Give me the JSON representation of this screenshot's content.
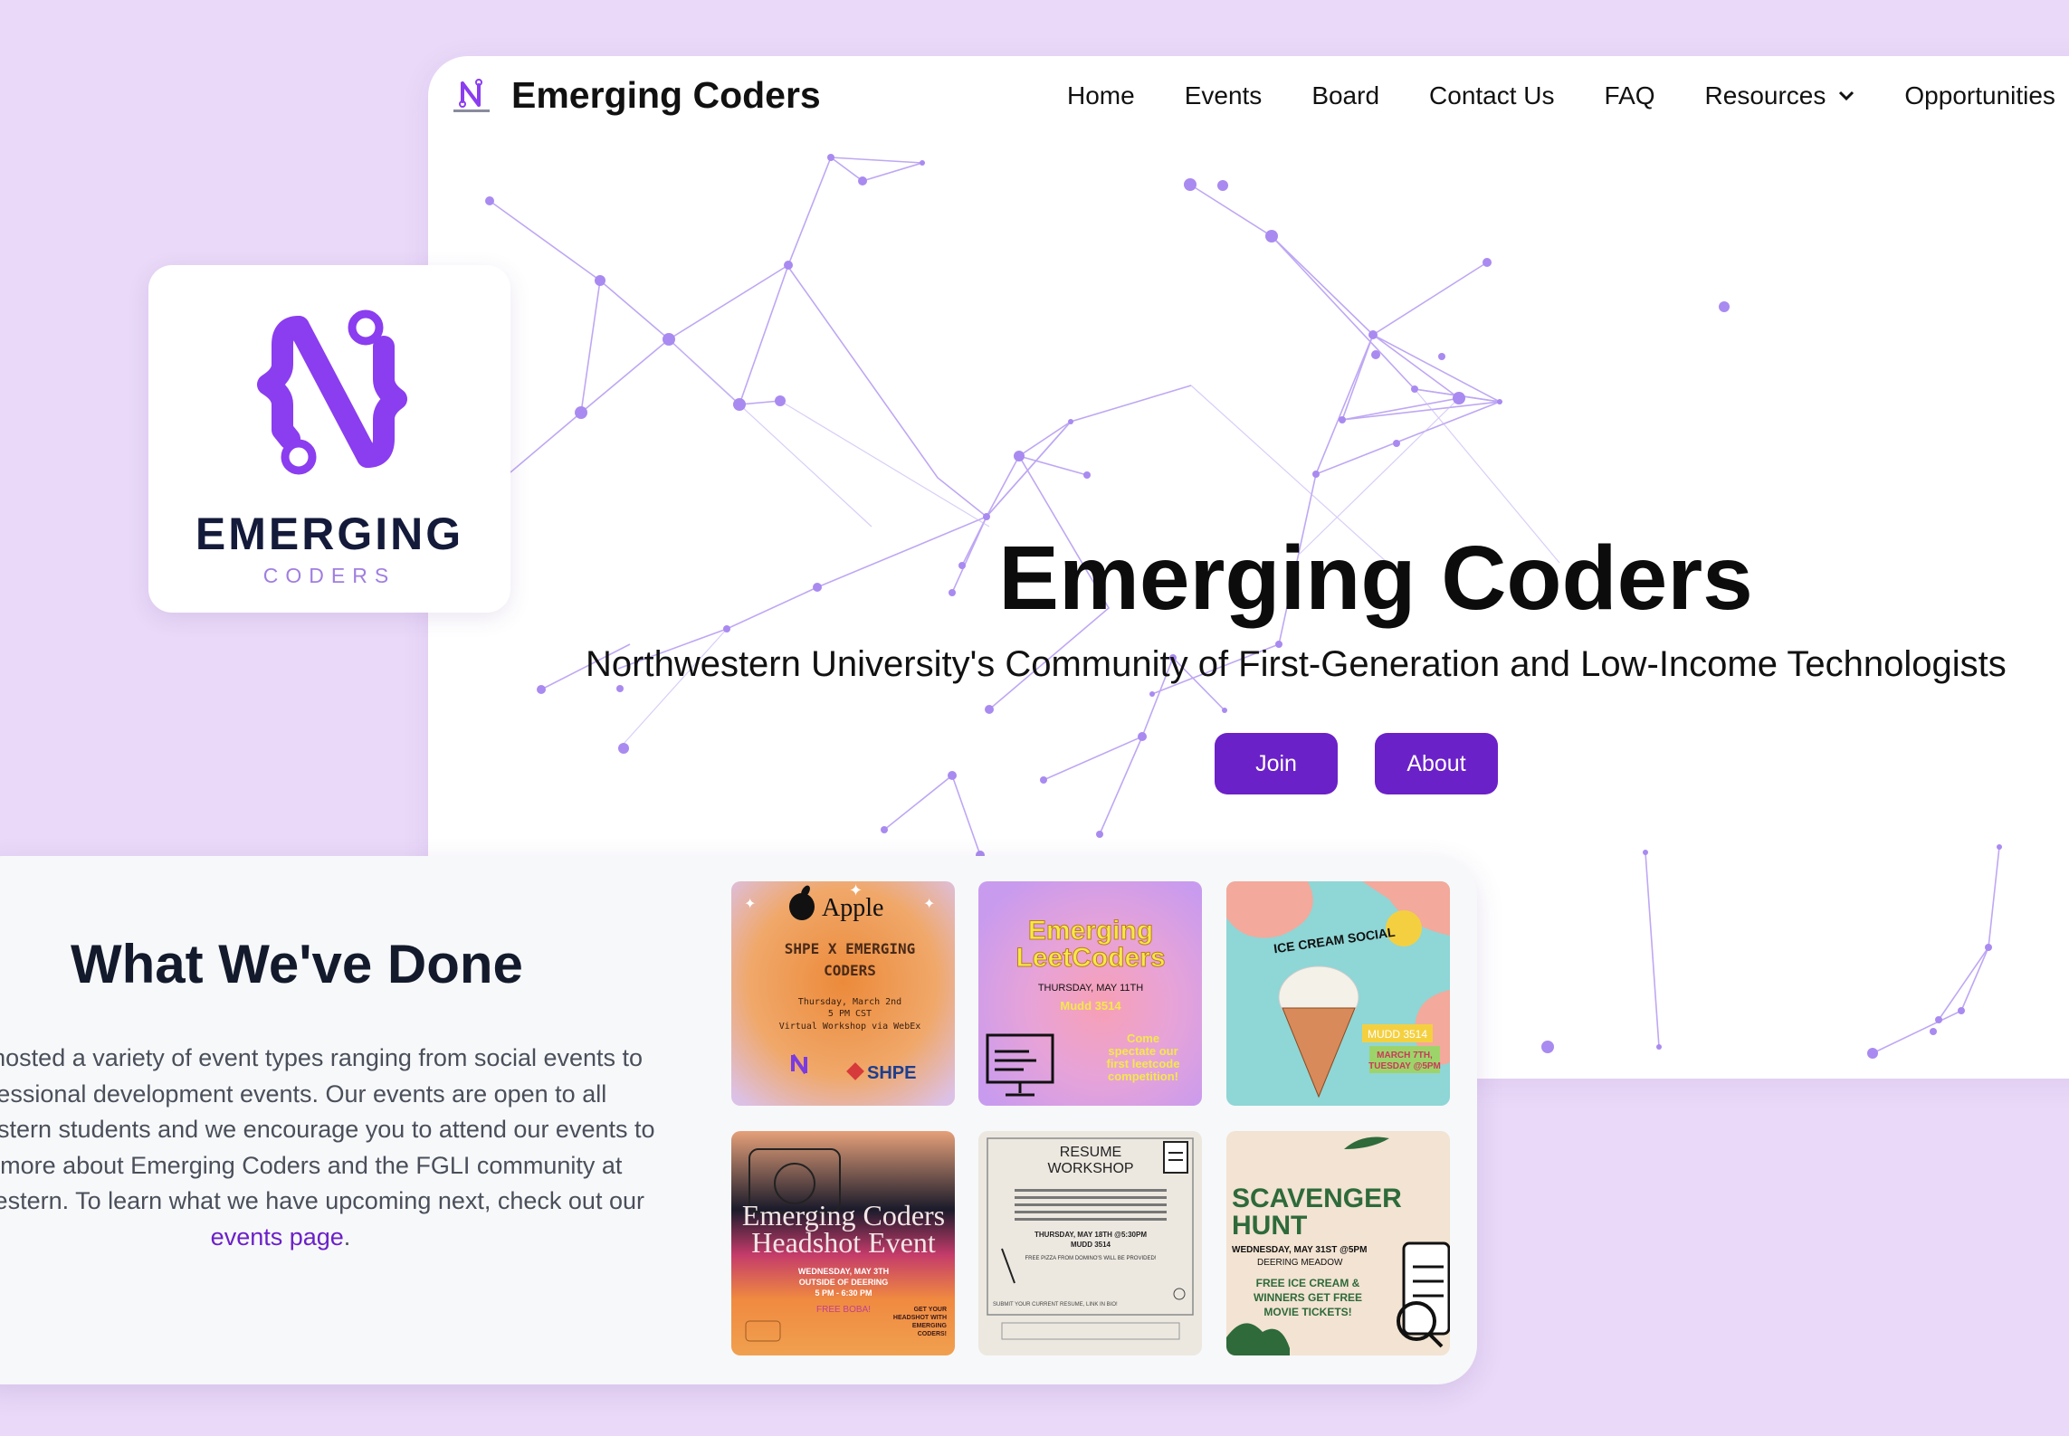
{
  "site": {
    "title": "Emerging Coders",
    "nav": [
      "Home",
      "Events",
      "Board",
      "Contact Us",
      "FAQ",
      "Resources",
      "Opportunities"
    ]
  },
  "hero": {
    "title": "Emerging Coders",
    "subtitle": "Northwestern University's Community of First-Generation and Low-Income Technologists",
    "join_label": "Join",
    "about_label": "About"
  },
  "logo_card": {
    "word": "EMERGING",
    "sub": "CODERS"
  },
  "done": {
    "title": "What We've Done",
    "text": "We've hosted a variety of event types ranging from social events to professional development events. Our events are open to all Northwestern students and we encourage you to attend our events to learn more about Emerging Coders and the FGLI community at Northwestern. To learn what we have upcoming next, check out our ",
    "link_label": "events page",
    "after_link": "."
  },
  "tiles": {
    "t1": {
      "brand": "Apple",
      "l1": "SHPE X EMERGING",
      "l2": "CODERS",
      "l3": "Thursday, March 2nd",
      "l4": "5 PM CST",
      "l5": "Virtual Workshop via WebEx",
      "partner": "SHPE"
    },
    "t2": {
      "l1": "Emerging",
      "l2": "LeetCoders",
      "l3": "THURSDAY, MAY 11TH",
      "l4": "Mudd 3514",
      "l5": "Come",
      "l6": "spectate our",
      "l7": "first leetcode",
      "l8": "competition!"
    },
    "t3": {
      "l1": "ICE CREAM SOCIAL",
      "l2": "MUDD 3514",
      "l3": "MARCH 7TH,",
      "l4": "TUESDAY @5PM"
    },
    "t4": {
      "l1": "Emerging Coders",
      "l2": "Headshot Event",
      "l3": "WEDNESDAY, MAY 3TH",
      "l4": "OUTSIDE OF DEERING",
      "l5": "5 PM - 6:30 PM",
      "l6": "FREE BOBA!",
      "l7": "GET YOUR",
      "l8": "HEADSHOT WITH",
      "l9": "EMERGING",
      "l10": "CODERS!"
    },
    "t5": {
      "l1": "RESUME",
      "l2": "WORKSHOP",
      "l3": "THURSDAY, MAY 18TH @5:30PM",
      "l4": "MUDD 3514",
      "l5": "FREE PIZZA FROM DOMINO'S WILL BE PROVIDED!",
      "l6": "SUBMIT YOUR CURRENT RESUME, LINK IN BIO!"
    },
    "t6": {
      "l1": "SCAVENGER",
      "l2": "HUNT",
      "l3": "WEDNESDAY, MAY 31ST @5PM",
      "l4": "DEERING MEADOW",
      "l5": "FREE ICE CREAM &",
      "l6": "WINNERS GET FREE",
      "l7": "MOVIE TICKETS!"
    }
  },
  "colors": {
    "background": "#ead9f8",
    "accent": "#6b21c8",
    "logo": "#8b3df0",
    "network": "#a98af0"
  },
  "icons": {
    "nav_logo": "emerging-coders-logo-icon",
    "dropdown": "chevron-down-icon"
  }
}
